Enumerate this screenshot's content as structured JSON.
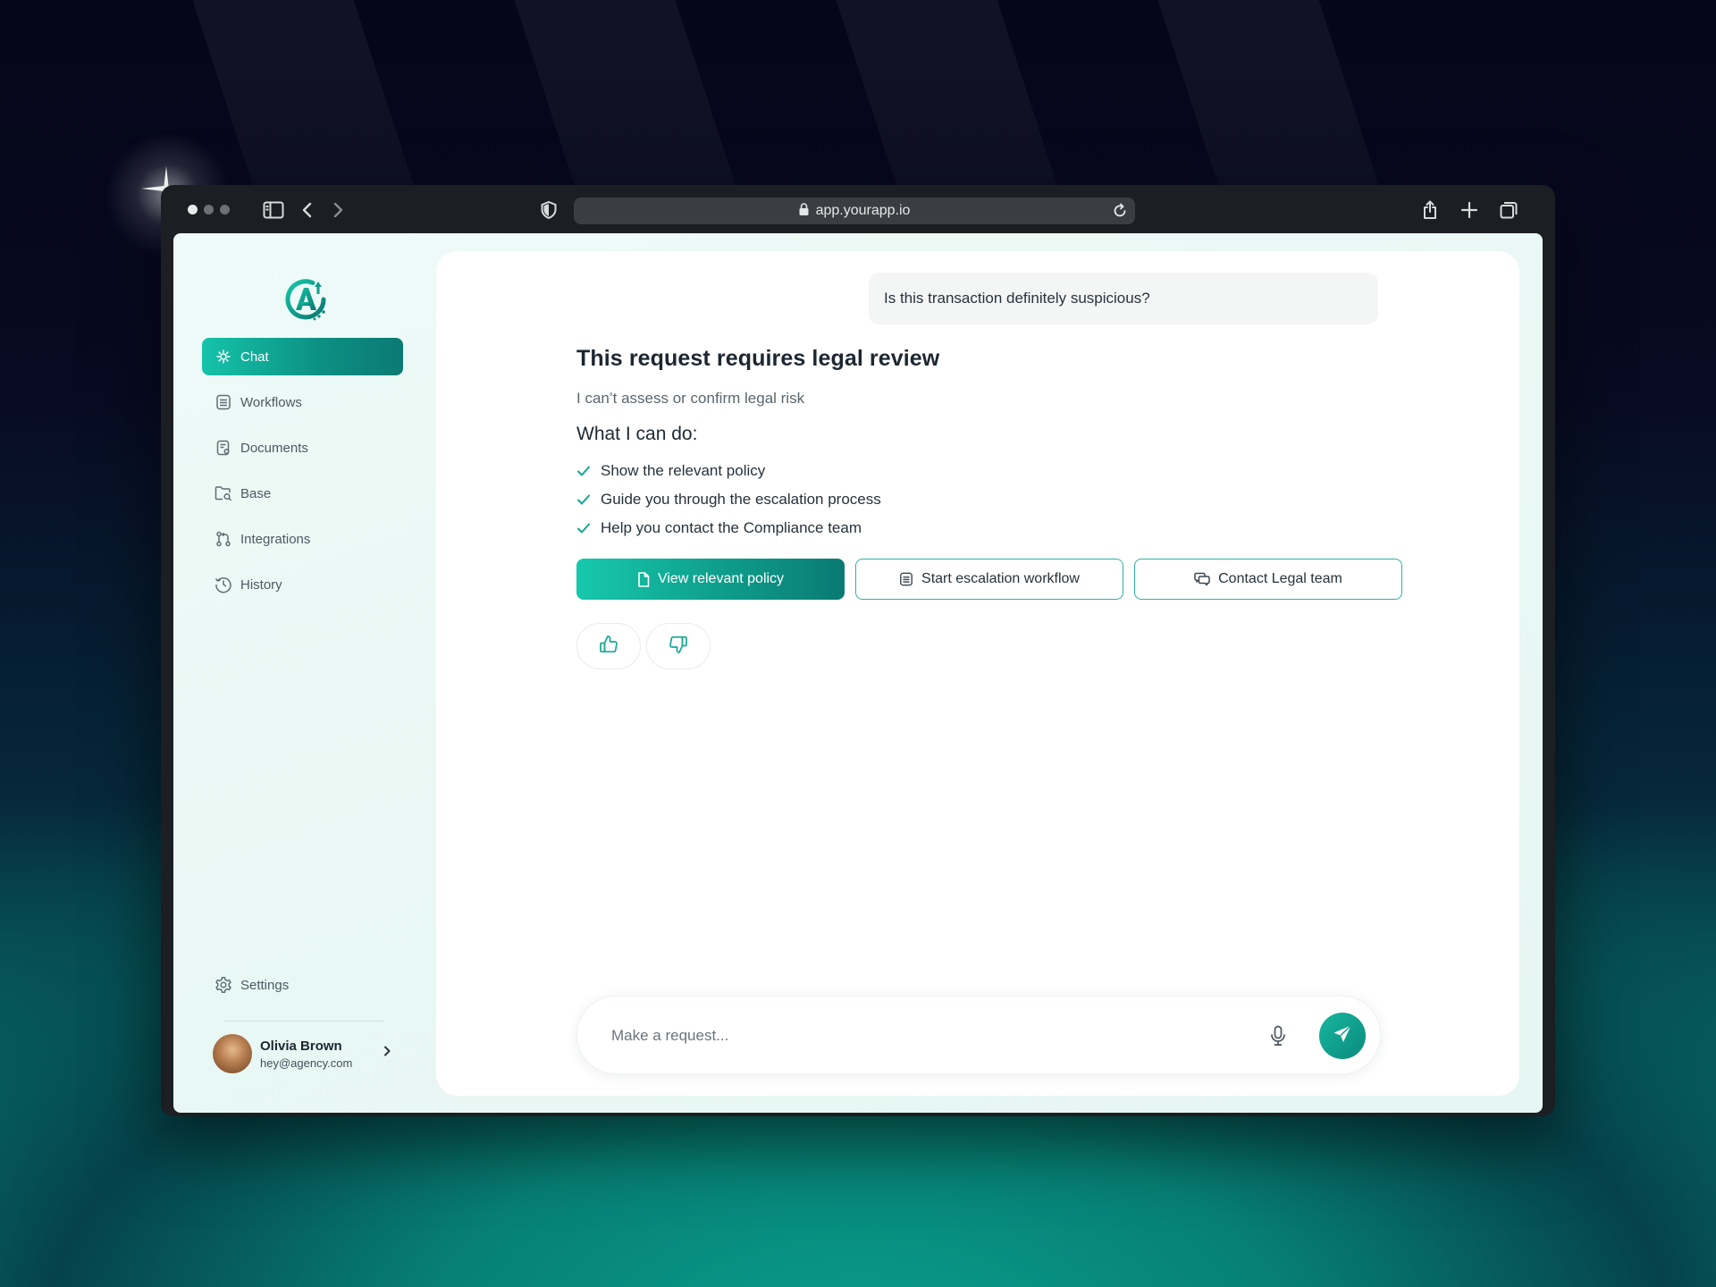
{
  "browser": {
    "url": "app.yourapp.io"
  },
  "sidebar": {
    "items": [
      {
        "label": "Chat",
        "icon": "sparkle-chat-icon",
        "active": true
      },
      {
        "label": "Workflows",
        "icon": "list-icon",
        "active": false
      },
      {
        "label": "Documents",
        "icon": "document-icon",
        "active": false
      },
      {
        "label": "Base",
        "icon": "folder-search-icon",
        "active": false
      },
      {
        "label": "Integrations",
        "icon": "git-branch-icon",
        "active": false
      },
      {
        "label": "History",
        "icon": "clock-icon",
        "active": false
      }
    ],
    "settings_label": "Settings",
    "user": {
      "name": "Olivia Brown",
      "email": "hey@agency.com"
    }
  },
  "chat": {
    "user_message": "Is this transaction definitely suspicious?",
    "response": {
      "title": "This request requires legal review",
      "subtitle": "I can’t assess or confirm legal risk",
      "heading": "What I can do:",
      "items": [
        "Show the relevant policy",
        "Guide you through the escalation process",
        "Help you contact the Compliance team"
      ]
    },
    "actions": [
      {
        "label": "View relevant policy",
        "icon": "document-icon",
        "style": "primary"
      },
      {
        "label": "Start escalation workflow",
        "icon": "list-icon",
        "style": "outline"
      },
      {
        "label": "Contact Legal team",
        "icon": "chat-bubbles-icon",
        "style": "outline"
      }
    ]
  },
  "composer": {
    "placeholder": "Make a request..."
  },
  "colors": {
    "accent": "#13a68f",
    "accent_dark": "#0a7a73",
    "accent_light": "#17c9ad"
  }
}
